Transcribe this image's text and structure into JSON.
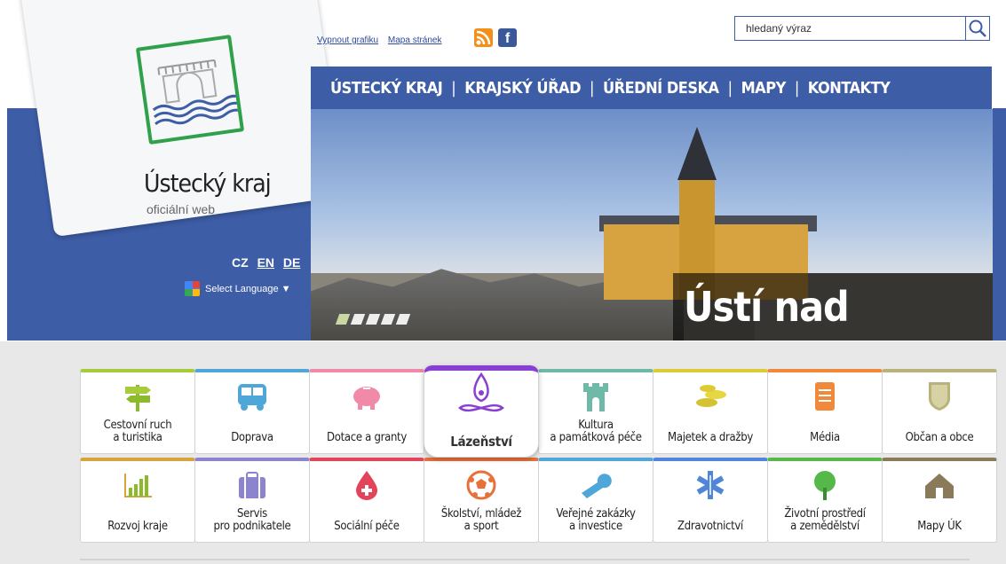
{
  "brand": {
    "name": "Ústecký kraj",
    "subtitle": "oficiální web",
    "logo": "castle-waves-logo"
  },
  "languages": [
    {
      "code": "CZ",
      "active": false
    },
    {
      "code": "EN",
      "active": true
    },
    {
      "code": "DE",
      "active": true
    }
  ],
  "select_language": "Select Language ▼",
  "top_links": {
    "disable_graphics": "Vypnout grafiku",
    "sitemap": "Mapa stránek"
  },
  "social": {
    "rss": "rss-icon",
    "facebook": "f"
  },
  "search": {
    "placeholder": "hledaný výraz",
    "icon": "search-icon"
  },
  "nav": {
    "items": [
      "ÚSTECKÝ KRAJ",
      "KRAJSKÝ ÚŘAD",
      "ÚŘEDNÍ DESKA",
      "MAPY",
      "KONTAKTY"
    ],
    "separator": "|"
  },
  "hero": {
    "caption": "Ústí nad Labem",
    "slides": 5,
    "current_slide": 1
  },
  "tiles": [
    {
      "label": "Cestovní ruch\na turistika",
      "icon": "signpost-icon",
      "color": "#a6cc3a"
    },
    {
      "label": "Doprava",
      "icon": "bus-icon",
      "color": "#4fa7d9"
    },
    {
      "label": "Dotace a granty",
      "icon": "piggy-bank-icon",
      "color": "#f08aa8"
    },
    {
      "label": "Lázeňství",
      "icon": "spa-lotus-icon",
      "color": "#8a3fd3",
      "active": true
    },
    {
      "label": "Kultura\na památková péče",
      "icon": "castle-icon",
      "color": "#6fb9a8"
    },
    {
      "label": "Majetek a dražby",
      "icon": "coins-icon",
      "color": "#dccb34"
    },
    {
      "label": "Média",
      "icon": "document-icon",
      "color": "#f0893a"
    },
    {
      "label": "Občan a obce",
      "icon": "shield-icon",
      "color": "#b9b27a"
    },
    {
      "label": "Rozvoj kraje",
      "icon": "bar-chart-icon",
      "color": "#d6a43a"
    },
    {
      "label": "Servis\npro podnikatele",
      "icon": "briefcase-icon",
      "color": "#8d84cf"
    },
    {
      "label": "Sociální péče",
      "icon": "medical-drop-icon",
      "color": "#e4445b"
    },
    {
      "label": "Školství, mládež\na sport",
      "icon": "football-icon",
      "color": "#e8703a"
    },
    {
      "label": "Veřejné zakázky\na investice",
      "icon": "wrench-icon",
      "color": "#4fa7d9"
    },
    {
      "label": "Zdravotnictví",
      "icon": "star-of-life-icon",
      "color": "#4f86d9"
    },
    {
      "label": "Životní prostředí\na zemědělství",
      "icon": "tree-icon",
      "color": "#55b848"
    },
    {
      "label": "Mapy ÚK",
      "icon": "house-map-icon",
      "color": "#8a7a5a"
    }
  ]
}
